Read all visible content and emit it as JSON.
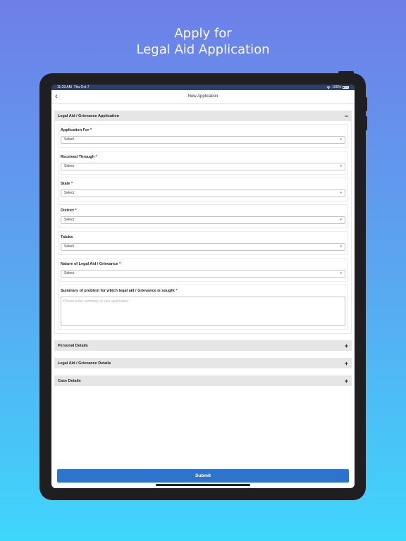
{
  "headline": {
    "line1": "Apply for",
    "line2": "Legal Aid Application"
  },
  "status_bar": {
    "time": "11:29 AM",
    "date": "Thu Oct 7",
    "battery": "100%"
  },
  "nav": {
    "back_icon": "chevron-left-icon",
    "title": "New Application"
  },
  "form": {
    "section_title": "Legal Aid / Grievance Application",
    "collapse_symbol": "−",
    "fields": [
      {
        "label": "Application For",
        "required": "*",
        "value": "Select"
      },
      {
        "label": "Received Through",
        "required": "*",
        "value": "Select"
      },
      {
        "label": "State",
        "required": "*",
        "value": "Select"
      },
      {
        "label": "District",
        "required": "*",
        "value": "Select"
      },
      {
        "label": "Taluka",
        "value": "Select"
      },
      {
        "label": "Nature of Legal Aid / Grievance",
        "required": "*",
        "value": "Select"
      }
    ],
    "summary": {
      "label": "Summary of problem for which legal aid / Grievance is sought",
      "required": "*",
      "placeholder": "Please enter summary of your application"
    }
  },
  "collapsed_sections": [
    {
      "title": "Personal Details",
      "symbol": "+"
    },
    {
      "title": "Legal Aid / Grievance Details",
      "symbol": "+"
    },
    {
      "title": "Case Details",
      "symbol": "+"
    }
  ],
  "submit_label": "Submit",
  "dropdown_caret": "▾",
  "colors": {
    "primary": "#2f74cc",
    "status_bar": "#2d3f66",
    "section_header": "#e6e6e6",
    "required": "#d0021b"
  }
}
